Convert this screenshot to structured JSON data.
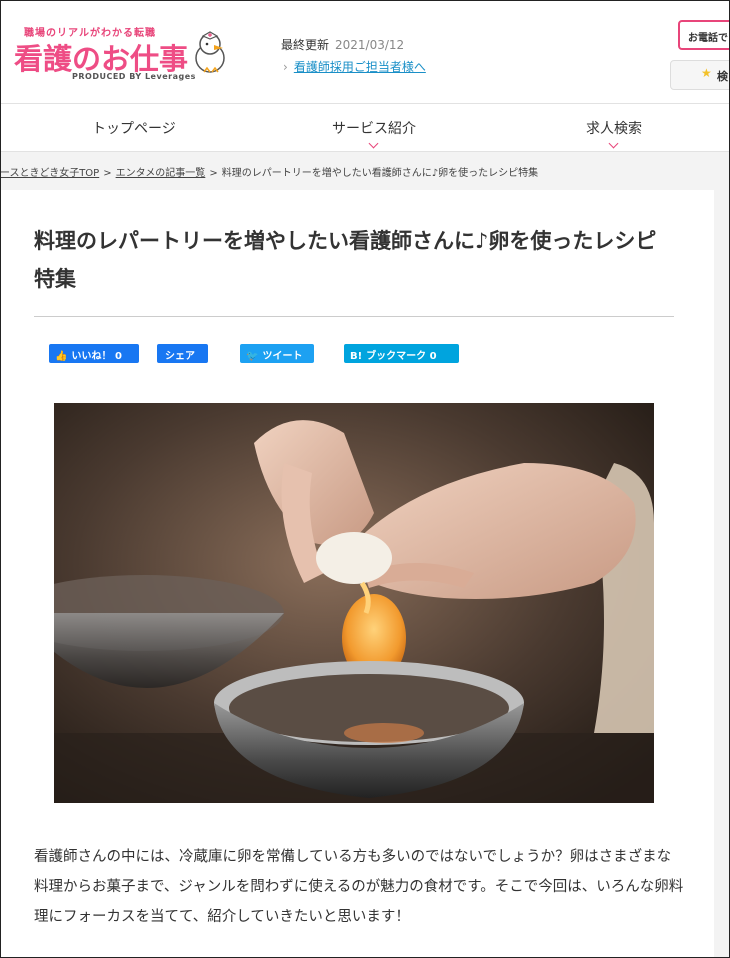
{
  "header": {
    "logo_tagline": "職場のリアルがわかる転職",
    "logo_main": "看護のお仕事",
    "logo_sub": "PRODUCED BY Leverages",
    "update_label": "最終更新",
    "update_date": "2021/03/12",
    "staff_link": "看護師採用ご担当者様へ",
    "call_button": "お電話で",
    "search_button": "検"
  },
  "nav": {
    "items": [
      {
        "label": "トップページ"
      },
      {
        "label": "サービス紹介"
      },
      {
        "label": "求人検索"
      }
    ]
  },
  "breadcrumb": {
    "items": [
      "ースときどき女子TOP",
      "エンタメの記事一覧"
    ],
    "current": "料理のレパートリーを増やしたい看護師さんに♪卵を使ったレシピ特集",
    "separator": ">"
  },
  "article": {
    "title": "料理のレパートリーを増やしたい看護師さんに♪卵を使ったレシピ特集",
    "intro": "看護師さんの中には、冷蔵庫に卵を常備している方も多いのではないでしょうか？卵はさまざまな料理からお菓子まで、ジャンルを問わずに使えるのが魅力の食材です。そこで今回は、いろんな卵料理にフォーカスを当てて、紹介していきたいと思います！"
  },
  "share": {
    "like_label": "いいね！",
    "like_count": "0",
    "share_label": "シェア",
    "tweet_label": "ツイート",
    "bookmark_label": "ブックマーク",
    "bookmark_count": "0",
    "bookmark_icon": "B!"
  },
  "colors": {
    "brand_pink": "#ee4d85",
    "link_blue": "#1a8fc7",
    "facebook": "#1877f2",
    "twitter": "#1da1f2",
    "hatena": "#00a4de"
  }
}
